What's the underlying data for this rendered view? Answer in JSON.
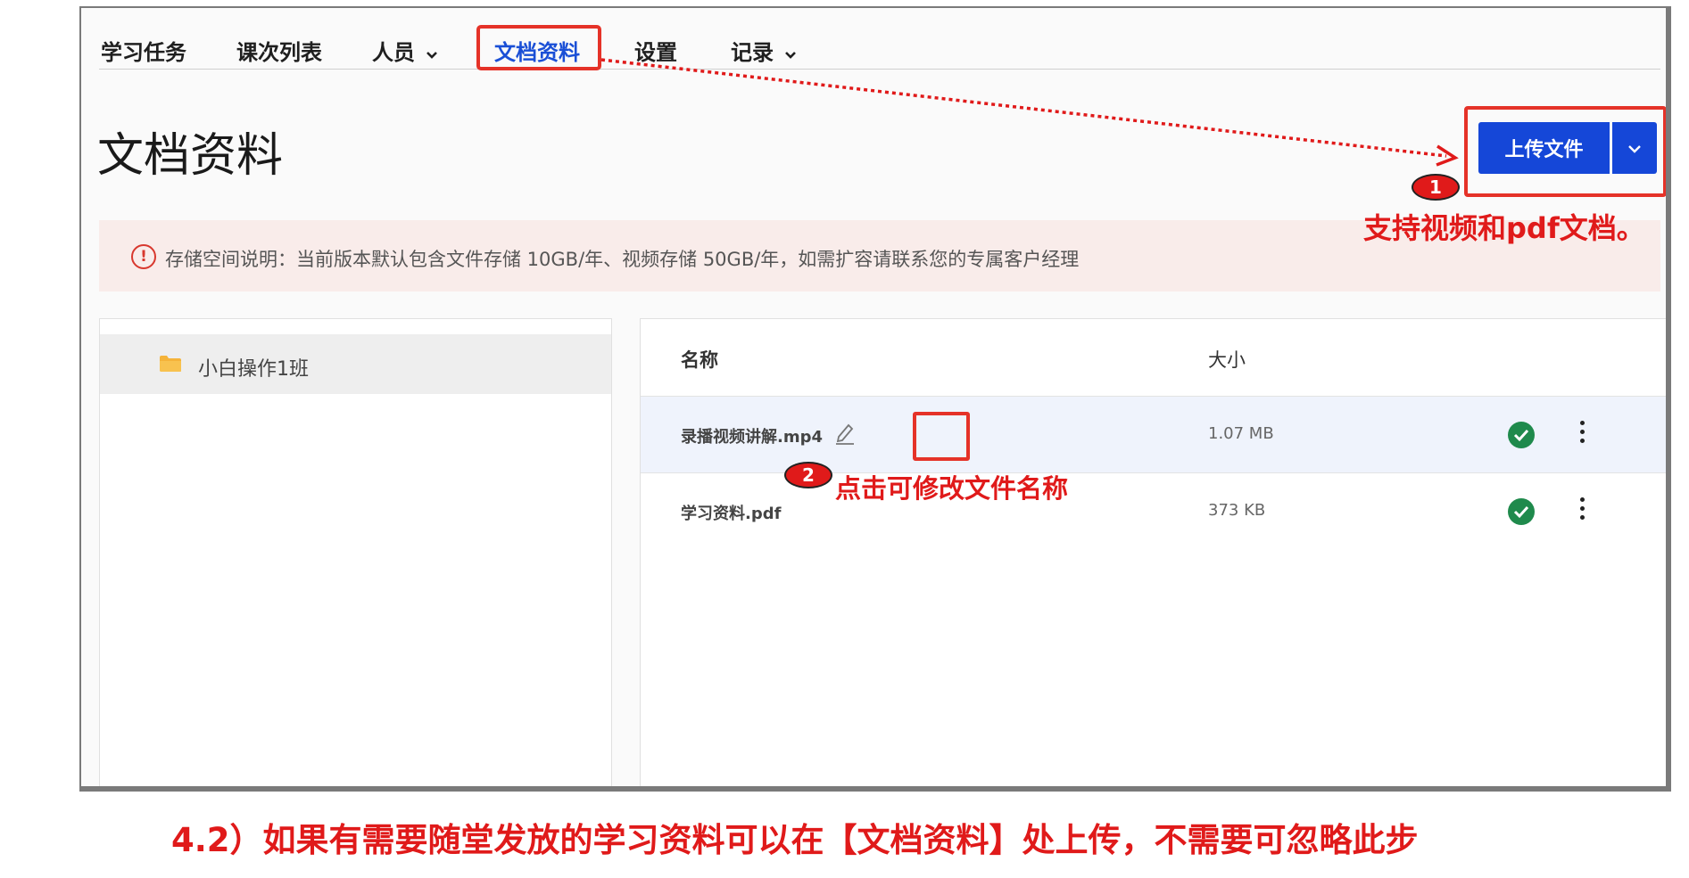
{
  "nav": {
    "items": [
      {
        "label": "学习任务"
      },
      {
        "label": "课次列表"
      },
      {
        "label": "人员",
        "dropdown": true
      },
      {
        "label": "文档资料",
        "active": true
      },
      {
        "label": "设置"
      },
      {
        "label": "记录",
        "dropdown": true
      }
    ]
  },
  "page": {
    "title": "文档资料"
  },
  "upload": {
    "label": "上传文件"
  },
  "notice": {
    "text": "存储空间说明：当前版本默认包含文件存储 10GB/年、视频存储 50GB/年，如需扩容请联系您的专属客户经理"
  },
  "sidebar": {
    "folders": [
      {
        "label": "小白操作1班",
        "selected": true
      }
    ]
  },
  "table": {
    "columns": {
      "name": "名称",
      "size": "大小"
    },
    "rows": [
      {
        "name": "录播视频讲解.mp4",
        "size": "1.07 MB",
        "status": "complete",
        "highlighted": true
      },
      {
        "name": "学习资料.pdf",
        "size": "373 KB",
        "status": "complete",
        "highlighted": false
      }
    ]
  },
  "annotations": {
    "one": {
      "badge": "1",
      "text": "支持视频和pdf文档。"
    },
    "two": {
      "badge": "2",
      "text": "点击可修改文件名称"
    },
    "caption": "4.2）如果有需要随堂发放的学习资料可以在【文档资料】处上传，不需要可忽略此步"
  },
  "colors": {
    "accent": "#1547d8",
    "annotation": "#e01a1a",
    "success": "#1f8a4c",
    "notice_bg": "#f9ecea"
  }
}
